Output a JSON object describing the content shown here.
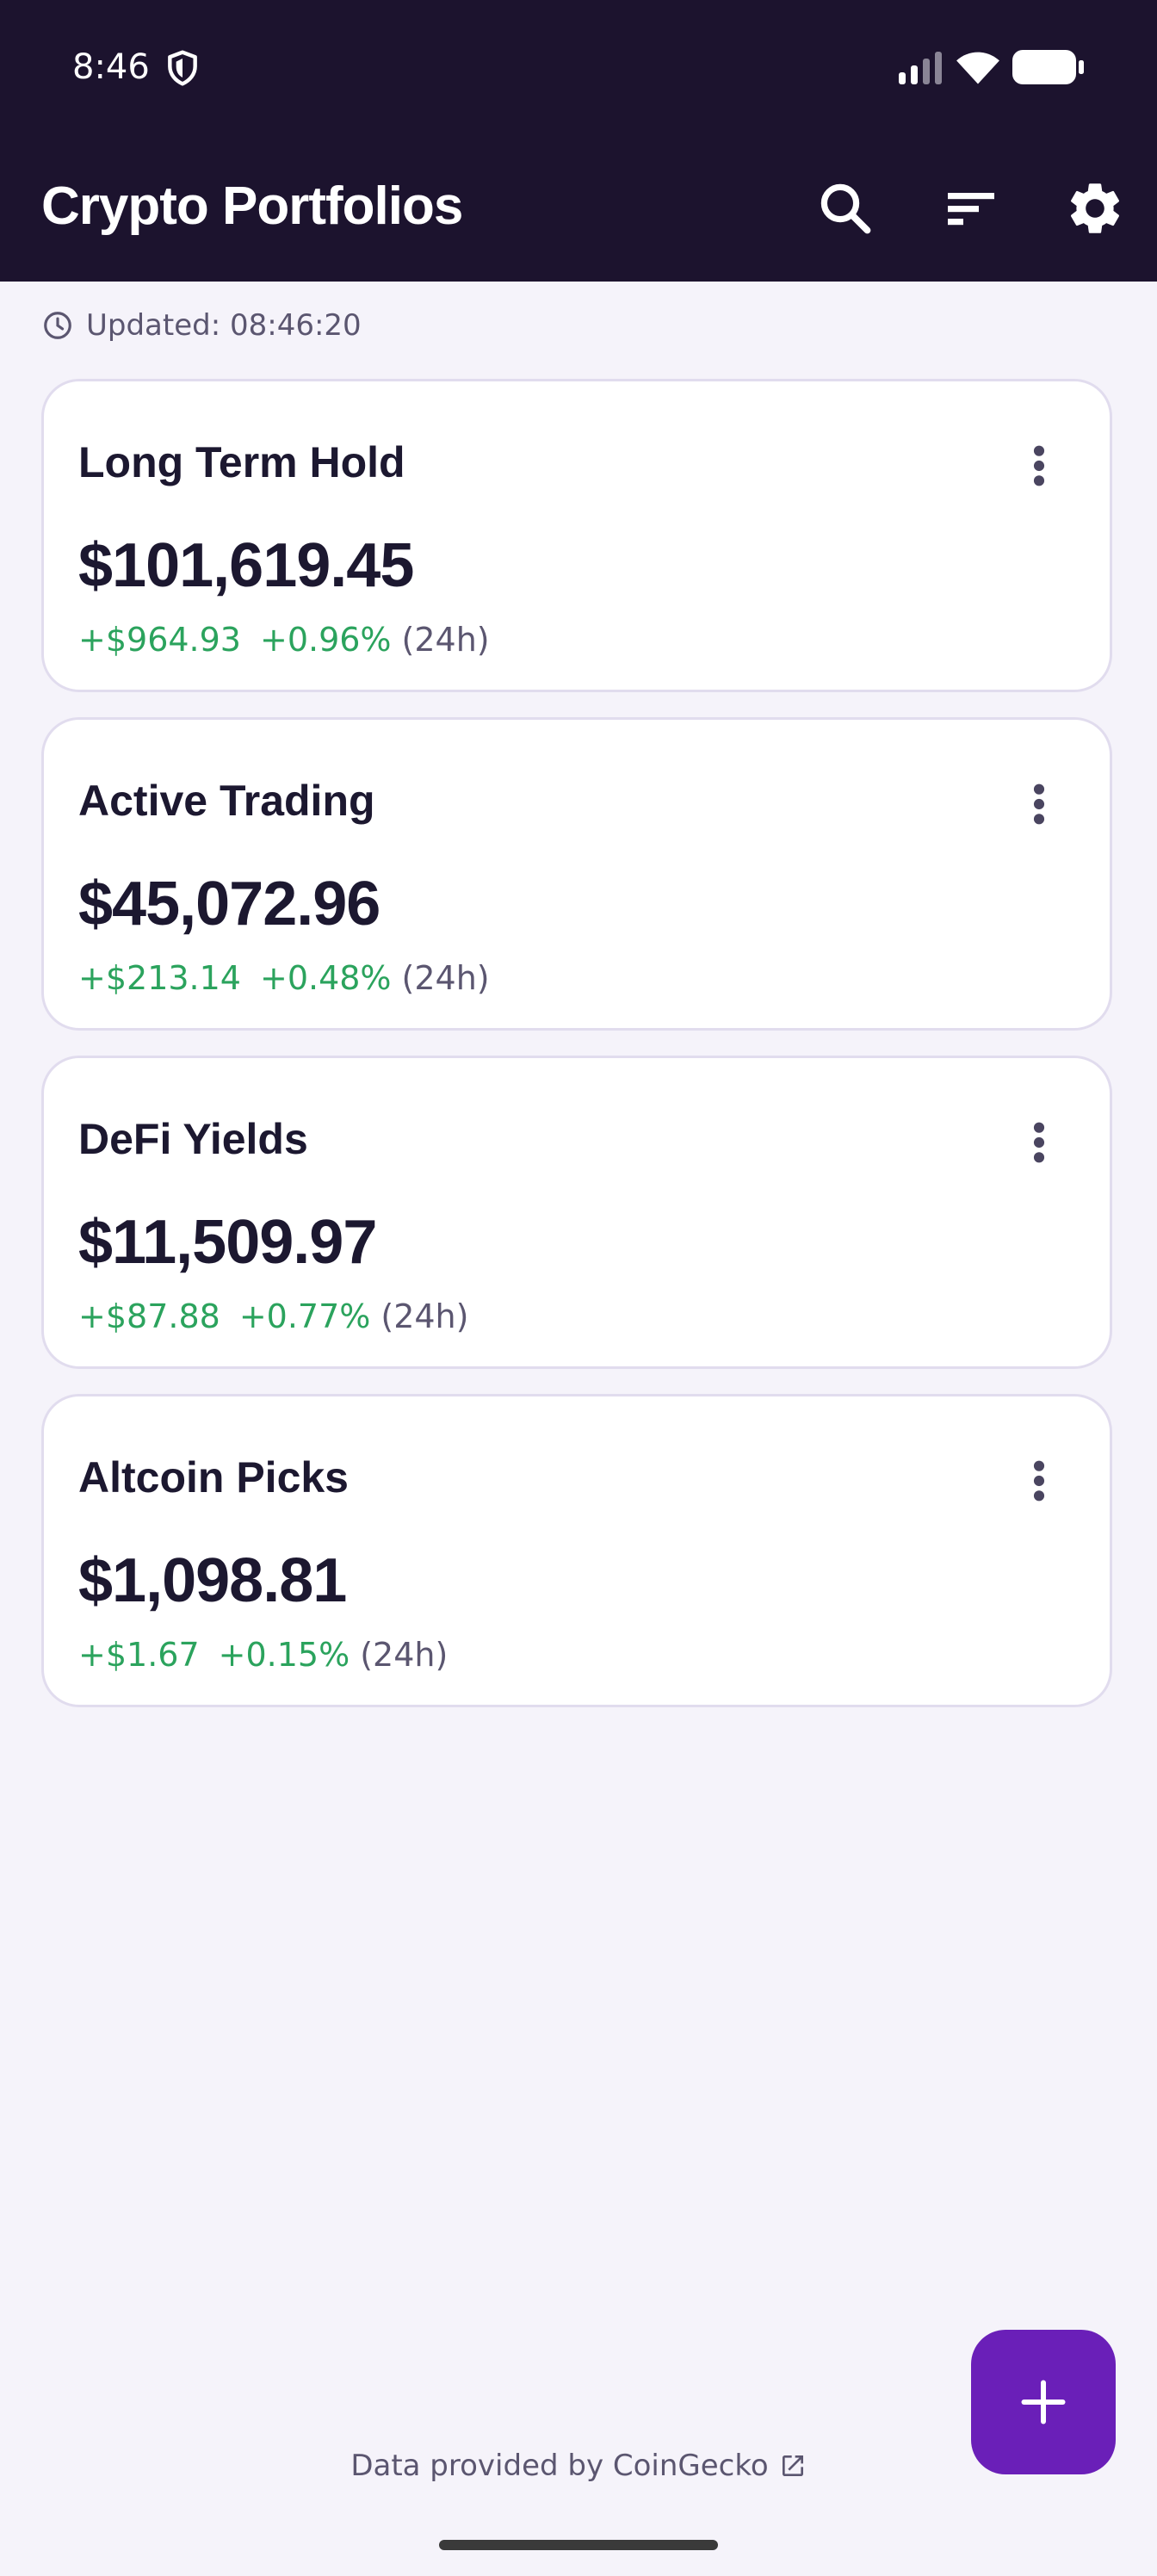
{
  "status_bar": {
    "time": "8:46"
  },
  "app_bar": {
    "title": "Crypto Portfolios",
    "icons": [
      "search-icon",
      "sort-icon",
      "settings-icon"
    ]
  },
  "updated": {
    "text": "Updated: 08:46:20",
    "icon": "clock-icon"
  },
  "portfolios": [
    {
      "name": "Long Term Hold",
      "value": "$101,619.45",
      "change_amount": "+$964.93",
      "change_percent": "+0.96%",
      "period": "(24h)"
    },
    {
      "name": "Active Trading",
      "value": "$45,072.96",
      "change_amount": "+$213.14",
      "change_percent": "+0.48%",
      "period": "(24h)"
    },
    {
      "name": "DeFi Yields",
      "value": "$11,509.97",
      "change_amount": "+$87.88",
      "change_percent": "+0.77%",
      "period": "(24h)"
    },
    {
      "name": "Altcoin Picks",
      "value": "$1,098.81",
      "change_amount": "+$1.67",
      "change_percent": "+0.15%",
      "period": "(24h)"
    }
  ],
  "footer": {
    "text": "Data provided by CoinGecko",
    "icon": "external-link-icon"
  },
  "fab": {
    "icon": "plus-icon"
  },
  "colors": {
    "topbar": "#1c132e",
    "background": "#f5f3fa",
    "positive": "#2ba35d",
    "fab": "#6a1fb8"
  }
}
